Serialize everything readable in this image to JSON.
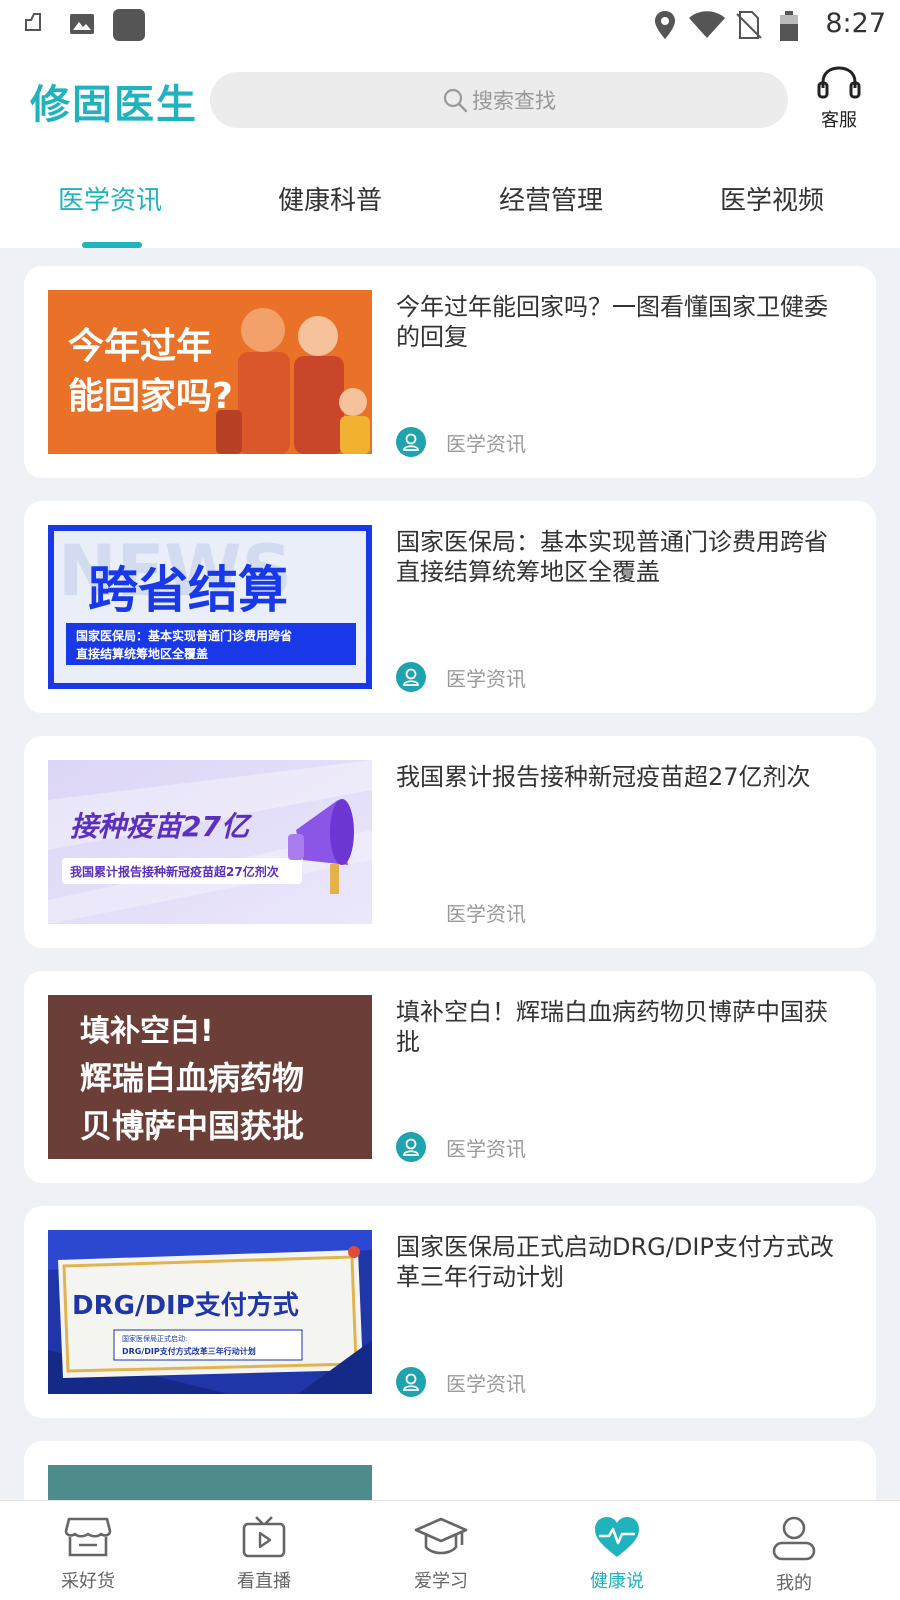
{
  "status_bar": {
    "time": "8:27"
  },
  "header": {
    "logo": "修固医生",
    "search_placeholder": "搜索查找",
    "service_label": "客服"
  },
  "tabs": [
    {
      "label": "医学资讯",
      "active": true
    },
    {
      "label": "健康科普",
      "active": false
    },
    {
      "label": "经营管理",
      "active": false
    },
    {
      "label": "医学视频",
      "active": false
    }
  ],
  "articles": [
    {
      "title": "今年过年能回家吗？一图看懂国家卫健委的回复",
      "source": "医学资讯",
      "thumb": {
        "line1": "今年过年",
        "line2": "能回家吗?"
      }
    },
    {
      "title": "国家医保局：基本实现普通门诊费用跨省直接结算统筹地区全覆盖",
      "source": "医学资讯",
      "thumb": {
        "headline": "跨省结算",
        "bg_word": "NEWS",
        "caption1": "国家医保局：基本实现普通门诊费用跨省",
        "caption2": "直接结算统筹地区全覆盖"
      }
    },
    {
      "title": "我国累计报告接种新冠疫苗超27亿剂次",
      "source": "医学资讯",
      "thumb": {
        "headline": "接种疫苗27亿",
        "caption": "我国累计报告接种新冠疫苗超27亿剂次"
      }
    },
    {
      "title": "填补空白！辉瑞白血病药物贝博萨中国获批",
      "source": "医学资讯",
      "thumb": {
        "line1": "填补空白!",
        "line2": "辉瑞白血病药物",
        "line3": "贝博萨中国获批"
      }
    },
    {
      "title": "国家医保局正式启动DRG/DIP支付方式改革三年行动计划",
      "source": "医学资讯",
      "thumb": {
        "headline": "DRG/DIP支付方式",
        "caption1": "国家医保局正式启动:",
        "caption2": "DRG/DIP支付方式改革三年行动计划"
      }
    }
  ],
  "bottom_nav": [
    {
      "label": "采好货",
      "icon": "store-icon",
      "active": false
    },
    {
      "label": "看直播",
      "icon": "tv-play-icon",
      "active": false
    },
    {
      "label": "爱学习",
      "icon": "graduation-cap-icon",
      "active": false
    },
    {
      "label": "健康说",
      "icon": "heart-pulse-icon",
      "active": true
    },
    {
      "label": "我的",
      "icon": "user-icon",
      "active": false
    }
  ],
  "colors": {
    "accent": "#21b3bd",
    "page_bg": "#eef1f5"
  }
}
